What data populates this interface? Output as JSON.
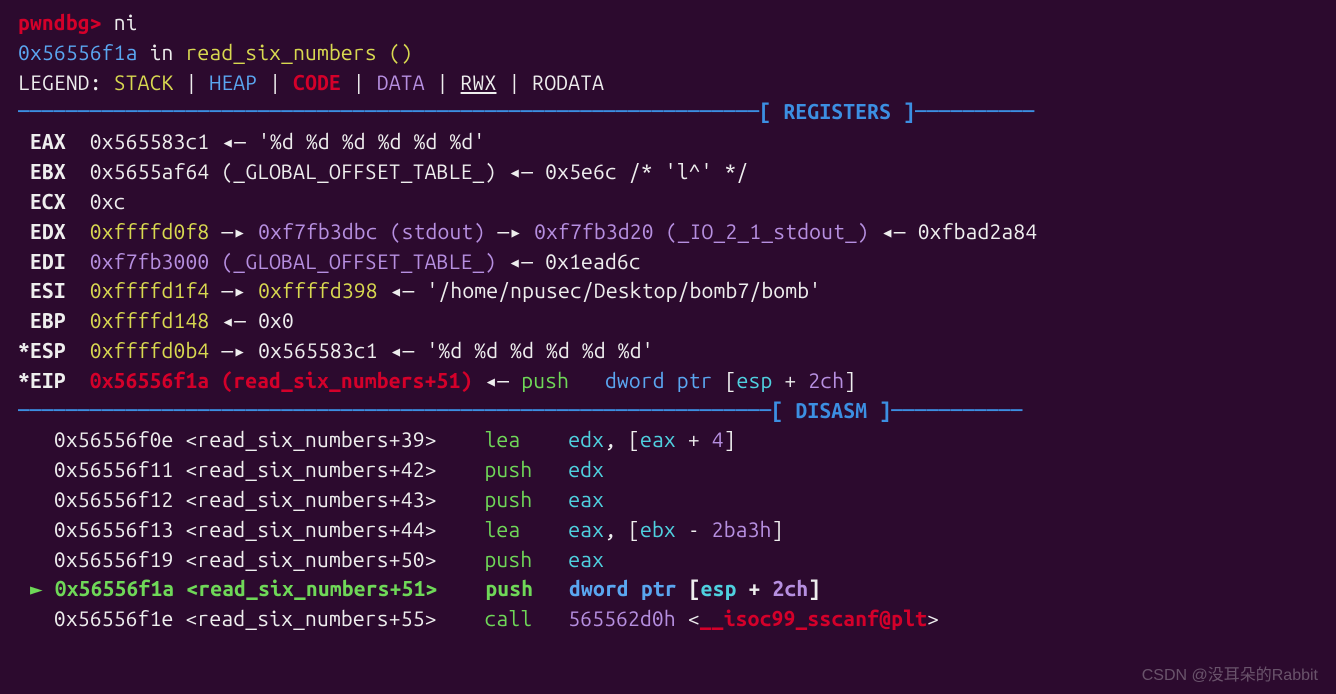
{
  "prompt": {
    "prefix": "pwndbg> ",
    "cmd": "ni"
  },
  "status_line": {
    "addr": "0x56556f1a",
    "in": " in ",
    "func": "read_six_numbers ()"
  },
  "legend": {
    "label": "LEGEND: ",
    "stack": "STACK",
    "heap": "HEAP",
    "code": "CODE",
    "data": "DATA",
    "rwx": "RWX",
    "rodata": "RODATA",
    "sep": " | "
  },
  "sections": {
    "registers": "REGISTERS",
    "disasm": "DISASM"
  },
  "regs": {
    "eax": {
      "n": " EAX  ",
      "v": "0x565583c1",
      "tail": " ◂— '%d %d %d %d %d %d'"
    },
    "ebx": {
      "n": " EBX  ",
      "v": "0x5655af64 ",
      "sym": "(_GLOBAL_OFFSET_TABLE_)",
      "tail": " ◂— 0x5e6c /* 'l^' */"
    },
    "ecx": {
      "n": " ECX  ",
      "v": "0xc"
    },
    "edx": {
      "n": " EDX  ",
      "v": "0xffffd0f8",
      "a1": " —▸ ",
      "p1": "0xf7fb3dbc ",
      "p1s": "(stdout)",
      "a2": " —▸ ",
      "p2": "0xf7fb3d20 ",
      "p2s": "(_IO_2_1_stdout_)",
      "a3": " ◂— 0xfbad2a84"
    },
    "edi": {
      "n": " EDI  ",
      "v": "0xf7fb3000 ",
      "sym": "(_GLOBAL_OFFSET_TABLE_)",
      "tail": " ◂— 0x1ead6c"
    },
    "esi": {
      "n": " ESI  ",
      "v": "0xffffd1f4",
      "a1": " —▸ ",
      "p1": "0xffffd398",
      "tail": " ◂— '/home/npusec/Desktop/bomb7/bomb'"
    },
    "ebp": {
      "n": " EBP  ",
      "v": "0xffffd148",
      "tail": " ◂— 0x0"
    },
    "esp": {
      "n": "*ESP  ",
      "v": "0xffffd0b4",
      "a1": " —▸ ",
      "p1": "0x565583c1",
      "tail": " ◂— '%d %d %d %d %d %d'"
    },
    "eip": {
      "n": "*EIP  ",
      "v": "0x56556f1a ",
      "sym": "(read_six_numbers+51)",
      "arr": " ◂— ",
      "m": "push   ",
      "op1": "dword ptr ",
      "br1": "[",
      "r": "esp ",
      "plus": "+ ",
      "off": "2ch",
      "br2": "]"
    }
  },
  "disasm": [
    {
      "cur": false,
      "pre": "   ",
      "addr": "0x56556f0e ",
      "sym": "<read_six_numbers+39>",
      "pad": "    ",
      "mn": "lea",
      "mpad": "    ",
      "ops": [
        {
          "t": "edx",
          "c": "cyan"
        },
        {
          "t": ", ",
          "c": "white"
        },
        {
          "t": "[",
          "c": "white"
        },
        {
          "t": "eax ",
          "c": "cyan"
        },
        {
          "t": "+ ",
          "c": "white"
        },
        {
          "t": "4",
          "c": "purple"
        },
        {
          "t": "]",
          "c": "white"
        }
      ]
    },
    {
      "cur": false,
      "pre": "   ",
      "addr": "0x56556f11 ",
      "sym": "<read_six_numbers+42>",
      "pad": "    ",
      "mn": "push",
      "mpad": "   ",
      "ops": [
        {
          "t": "edx",
          "c": "cyan"
        }
      ]
    },
    {
      "cur": false,
      "pre": "   ",
      "addr": "0x56556f12 ",
      "sym": "<read_six_numbers+43>",
      "pad": "    ",
      "mn": "push",
      "mpad": "   ",
      "ops": [
        {
          "t": "eax",
          "c": "cyan"
        }
      ]
    },
    {
      "cur": false,
      "pre": "   ",
      "addr": "0x56556f13 ",
      "sym": "<read_six_numbers+44>",
      "pad": "    ",
      "mn": "lea",
      "mpad": "    ",
      "ops": [
        {
          "t": "eax",
          "c": "cyan"
        },
        {
          "t": ", ",
          "c": "white"
        },
        {
          "t": "[",
          "c": "white"
        },
        {
          "t": "ebx ",
          "c": "cyan"
        },
        {
          "t": "- ",
          "c": "white"
        },
        {
          "t": "2ba3h",
          "c": "purple"
        },
        {
          "t": "]",
          "c": "white"
        }
      ]
    },
    {
      "cur": false,
      "pre": "   ",
      "addr": "0x56556f19 ",
      "sym": "<read_six_numbers+50>",
      "pad": "    ",
      "mn": "push",
      "mpad": "   ",
      "ops": [
        {
          "t": "eax",
          "c": "cyan"
        }
      ]
    },
    {
      "cur": true,
      "pre": " ► ",
      "addr": "0x56556f1a ",
      "sym": "<read_six_numbers+51>",
      "pad": "    ",
      "mn": "push",
      "mpad": "   ",
      "ops": [
        {
          "t": "dword ptr ",
          "c": "blue"
        },
        {
          "t": "[",
          "c": "white"
        },
        {
          "t": "esp ",
          "c": "cyan"
        },
        {
          "t": "+ ",
          "c": "white"
        },
        {
          "t": "2ch",
          "c": "purple"
        },
        {
          "t": "]",
          "c": "white"
        }
      ]
    },
    {
      "cur": false,
      "pre": "   ",
      "addr": "0x56556f1e ",
      "sym": "<read_six_numbers+55>",
      "pad": "    ",
      "mn": "call",
      "mpad": "   ",
      "ops": [
        {
          "t": "565562d0h ",
          "c": "purple"
        },
        {
          "t": "<",
          "c": "white"
        },
        {
          "t": "__isoc99_sscanf@plt",
          "c": "red2"
        },
        {
          "t": ">",
          "c": "white"
        }
      ]
    }
  ],
  "watermark": "CSDN @没耳朵的Rabbit"
}
